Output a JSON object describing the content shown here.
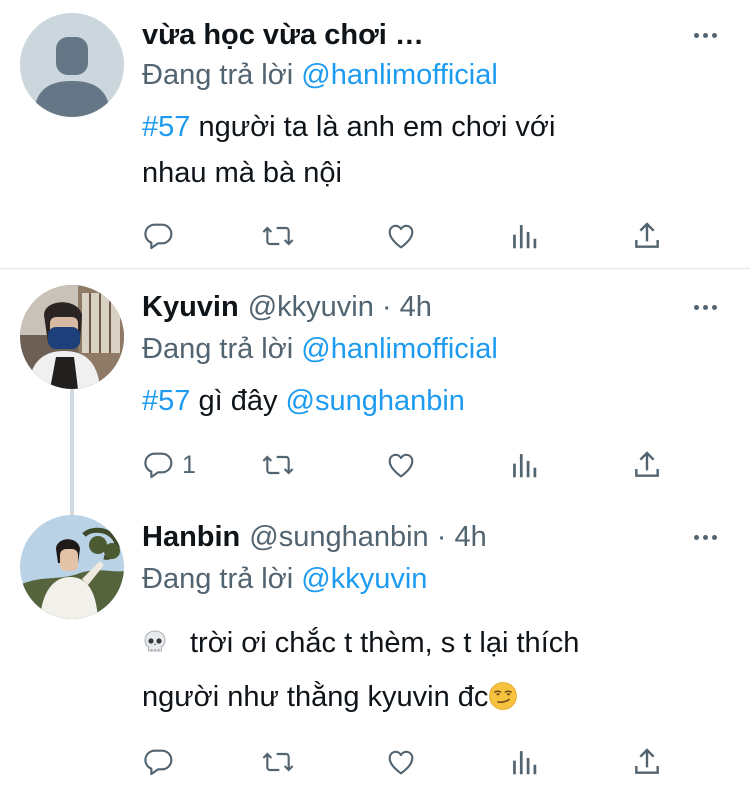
{
  "tweets": [
    {
      "name": "vừa học vừa chơi …",
      "handle": "",
      "time": "",
      "reply_prefix": "Đang trả lời ",
      "reply_to": "@hanlimofficial",
      "hashtag": "#57",
      "text_1": " người ta là anh em chơi với",
      "text_2": "nhau mà bà nội",
      "reply_count": "",
      "avatar": "default-avatar"
    },
    {
      "name": "Kyuvin",
      "handle": "@kkyuvin · 4h",
      "reply_prefix": "Đang trả lời ",
      "reply_to": "@hanlimofficial",
      "hashtag": "#57",
      "text_mid": " gì đây ",
      "mention": "@sunghanbin",
      "reply_count": "1",
      "avatar": "kyuvin-avatar"
    },
    {
      "name": "Hanbin",
      "handle": "@sunghanbin · 4h",
      "reply_prefix": "Đang trả lời ",
      "reply_to": "@kkyuvin",
      "skull": "💀",
      "text_1": "trời ơi chắc t thèm, s t lại thích",
      "text_2": "người như thằng kyuvin đc",
      "smirk": "😏",
      "reply_count": "",
      "avatar": "hanbin-avatar"
    }
  ],
  "colors": {
    "link": "#1d9bf0",
    "muted": "#536471",
    "text": "#0f1419",
    "divider": "#e1e8ed"
  },
  "icons": [
    "reply-icon",
    "retweet-icon",
    "like-icon",
    "analytics-icon",
    "share-icon",
    "more-icon"
  ]
}
